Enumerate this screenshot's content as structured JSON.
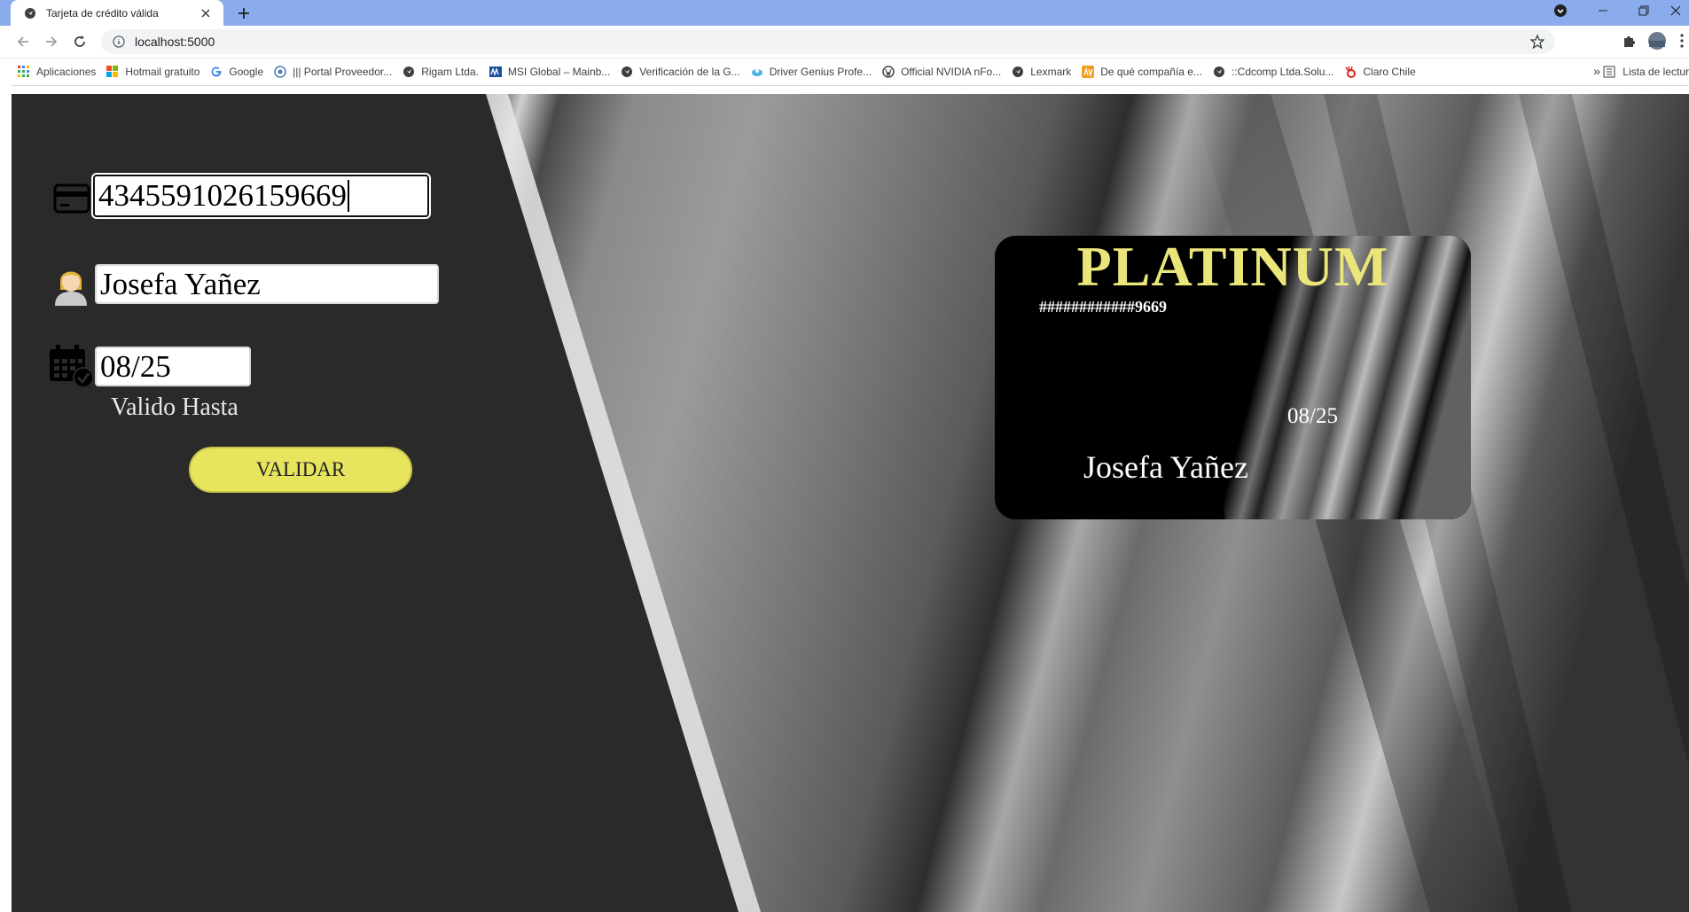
{
  "browser": {
    "tab_title": "Tarjeta de crédito válida",
    "url": "localhost:5000",
    "bookmarks": [
      {
        "label": "Aplicaciones",
        "icon": "apps-grid-icon"
      },
      {
        "label": "Hotmail gratuito",
        "icon": "microsoft-logo-icon"
      },
      {
        "label": "Google",
        "icon": "google-g-icon"
      },
      {
        "label": "||| Portal Proveedor...",
        "icon": "portal-icon"
      },
      {
        "label": "Rigam Ltda.",
        "icon": "globe-icon"
      },
      {
        "label": "MSI Global – Mainb...",
        "icon": "msi-icon"
      },
      {
        "label": "Verificación de la G...",
        "icon": "globe-icon"
      },
      {
        "label": "Driver Genius Profe...",
        "icon": "driver-genius-icon"
      },
      {
        "label": "Official NVIDIA nFo...",
        "icon": "wordpress-icon"
      },
      {
        "label": "Lexmark",
        "icon": "globe-icon"
      },
      {
        "label": "De qué compañía e...",
        "icon": "av-icon"
      },
      {
        "label": "::Cdcomp Ltda.Solu...",
        "icon": "globe-icon"
      },
      {
        "label": "Claro Chile",
        "icon": "claro-icon"
      }
    ],
    "bookmarks_more": "»",
    "reading_list": "Lista de lectur"
  },
  "form": {
    "card_number": "4345591026159669",
    "holder_name": "Josefa Yañez",
    "expiry": "08/25",
    "expiry_label": "Valido Hasta",
    "submit_label": "VALIDAR"
  },
  "card": {
    "brand": "PLATINUM",
    "masked_number": "############9669",
    "expiry": "08/25",
    "holder": "Josefa Yañez"
  },
  "colors": {
    "page_background": "#2a2a2a",
    "accent_yellow": "#e7e45e",
    "brand_text": "#eae67a",
    "tab_strip": "#8aacec"
  }
}
